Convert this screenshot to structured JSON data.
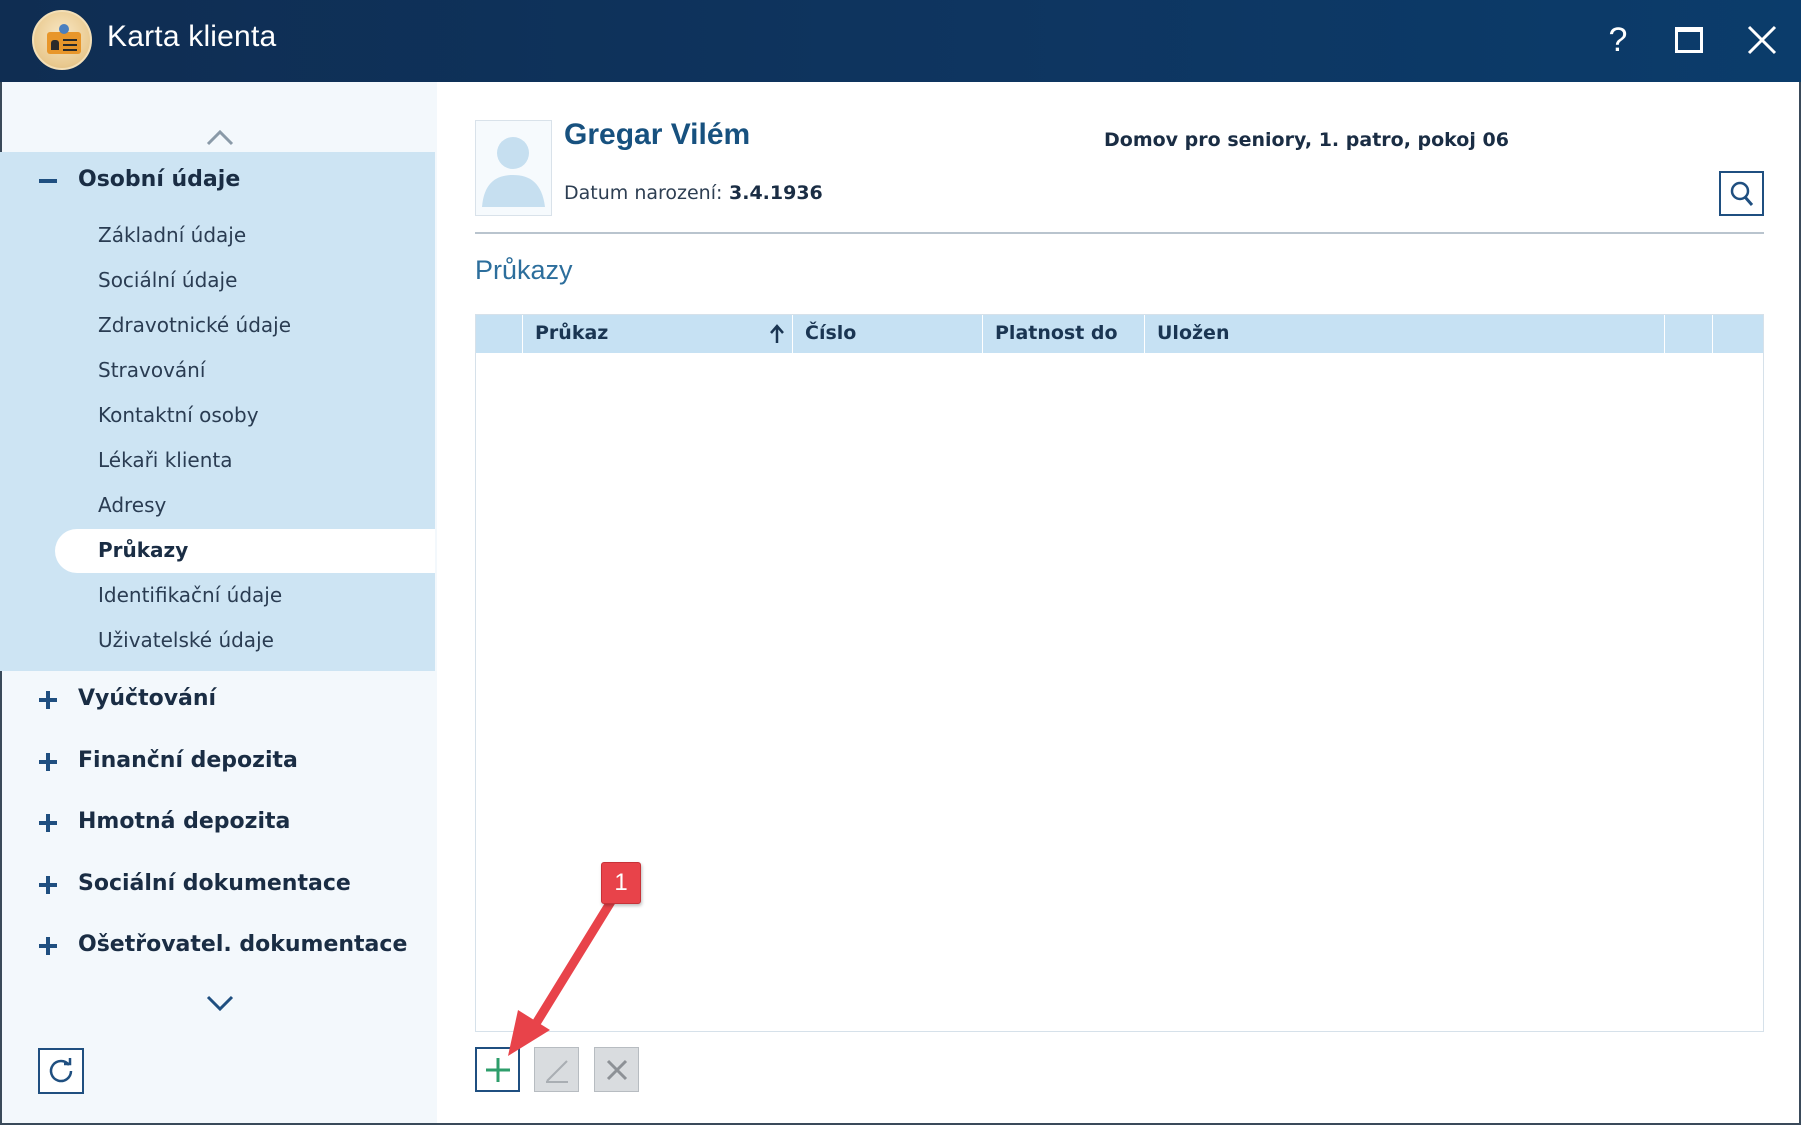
{
  "window": {
    "title": "Karta klienta",
    "help_glyph": "?"
  },
  "sidebar": {
    "groups": [
      {
        "label": "Osobní údaje",
        "expanded": true,
        "items": [
          {
            "label": "Základní údaje"
          },
          {
            "label": "Sociální údaje"
          },
          {
            "label": "Zdravotnické údaje"
          },
          {
            "label": "Stravování"
          },
          {
            "label": "Kontaktní osoby"
          },
          {
            "label": "Lékaři klienta"
          },
          {
            "label": "Adresy"
          },
          {
            "label": "Průkazy",
            "active": true
          },
          {
            "label": "Identifikační údaje"
          },
          {
            "label": "Uživatelské údaje"
          }
        ]
      },
      {
        "label": "Vyúčtování",
        "expanded": false
      },
      {
        "label": "Finanční depozita",
        "expanded": false
      },
      {
        "label": "Hmotná depozita",
        "expanded": false
      },
      {
        "label": "Sociální dokumentace",
        "expanded": false
      },
      {
        "label": "Ošetřovatel. dokumentace",
        "expanded": false
      }
    ]
  },
  "client": {
    "name": "Gregar Vilém",
    "dob_label": "Datum narození:",
    "dob_value": "3.4.1936",
    "location": "Domov pro seniory, 1. patro, pokoj 06"
  },
  "section": {
    "title": "Průkazy"
  },
  "grid": {
    "columns": [
      {
        "label": ""
      },
      {
        "label": "Průkaz",
        "sorted": "ascending"
      },
      {
        "label": "Číslo"
      },
      {
        "label": "Platnost do"
      },
      {
        "label": "Uložen"
      },
      {
        "label": ""
      },
      {
        "label": ""
      }
    ],
    "rows": []
  },
  "annotation": {
    "number": "1"
  },
  "colors": {
    "titlebar": "#0e3560",
    "sidebar_open_group": "#cde4f3",
    "grid_header": "#c6e1f3",
    "accent": "#17517f",
    "add_icon": "#2e9e6b",
    "annotation": "#e8434a"
  },
  "icons": {
    "app": "client-card-icon",
    "help": "help-icon",
    "maximize": "maximize-icon",
    "close": "close-icon",
    "expand": "plus-icon",
    "collapse": "minus-icon",
    "scroll_up": "chevron-up-icon",
    "scroll_down": "chevron-down-icon",
    "refresh": "refresh-icon",
    "search": "search-icon",
    "add": "plus-icon",
    "edit": "pencil-icon",
    "delete": "cross-icon",
    "sort": "arrow-up-icon"
  }
}
